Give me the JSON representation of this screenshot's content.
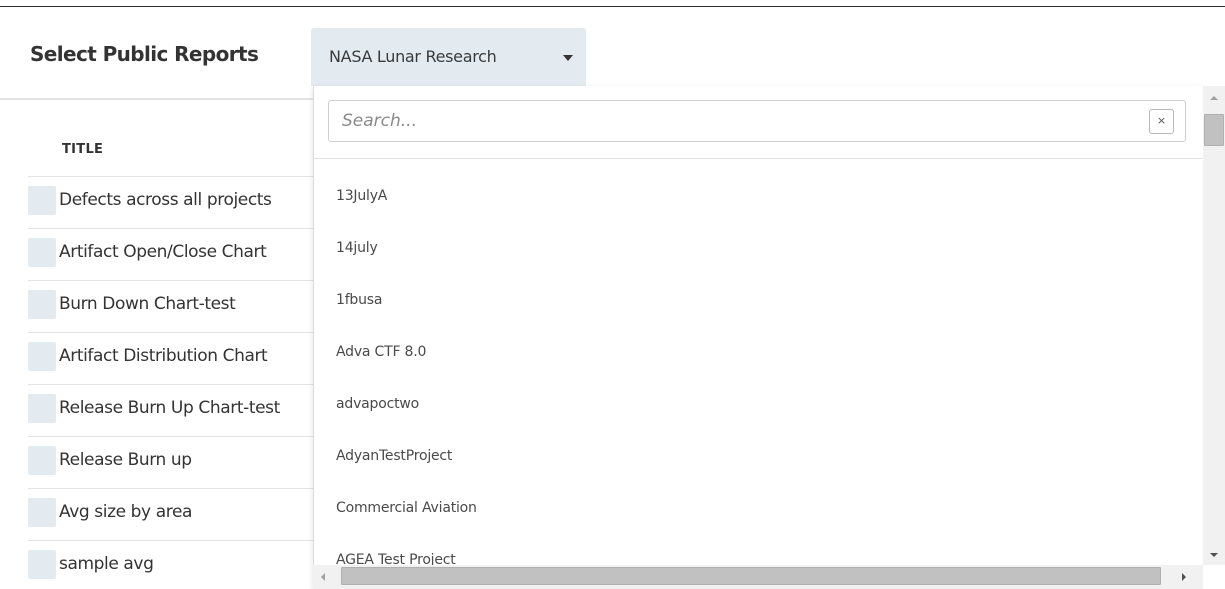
{
  "header": {
    "title": "Select Public Reports",
    "project_selector": {
      "selected": "NASA Lunar Research",
      "icon": "caret-down-icon"
    }
  },
  "table": {
    "column_title": "TITLE",
    "rows": [
      {
        "title": "Defects across all projects"
      },
      {
        "title": "Artifact Open/Close Chart"
      },
      {
        "title": "Burn Down Chart-test"
      },
      {
        "title": "Artifact Distribution Chart"
      },
      {
        "title": "Release Burn Up Chart-test"
      },
      {
        "title": "Release Burn up"
      },
      {
        "title": "Avg size by area"
      },
      {
        "title": "sample avg"
      }
    ]
  },
  "dropdown": {
    "search": {
      "placeholder": "Search...",
      "value": "",
      "clear_label": "×"
    },
    "options": [
      "13JulyA",
      "14july",
      "1fbusa",
      "Adva CTF 8.0",
      "advapoctwo",
      "AdyanTestProject",
      "Commercial Aviation",
      "AGEA Test Project"
    ]
  },
  "colors": {
    "accent_bg": "#e4ebf0",
    "divider": "#e3e3e3",
    "text": "#333333"
  }
}
